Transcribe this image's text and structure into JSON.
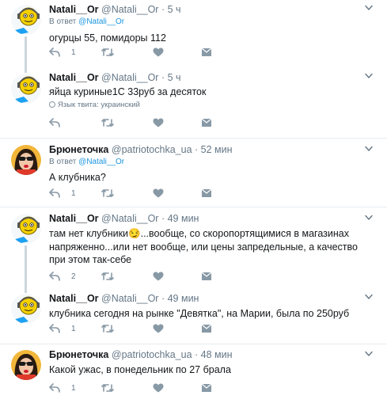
{
  "tweets": [
    {
      "name": "Natali__Or",
      "handle": "@Natali__Or",
      "dot": "·",
      "time": "5 ч",
      "reply_prefix": "В ответ",
      "reply_to": "@Natali__Or",
      "text": "огурцы 55, помидоры 112",
      "reply_count": "1",
      "lang": ""
    },
    {
      "name": "Natali__Or",
      "handle": "@Natali__Or",
      "dot": "·",
      "time": "5 ч",
      "reply_prefix": "",
      "reply_to": "",
      "text": "яйца куриные1С 33руб за десяток",
      "reply_count": "",
      "lang": "Язык твита: украинский"
    },
    {
      "name": "Брюнеточка",
      "handle": "@patriotochka_ua",
      "dot": "·",
      "time": "52 мин",
      "reply_prefix": "В ответ",
      "reply_to": "@Natali__Or",
      "text": "А клубника?",
      "reply_count": "1",
      "lang": ""
    },
    {
      "name": "Natali__Or",
      "handle": "@Natali__Or",
      "dot": "·",
      "time": "49 мин",
      "reply_prefix": "",
      "reply_to": "",
      "text": "там нет клубники😏...вообще, со скоропортящимися в магазинах напряженно...или нет вообще, или цены запредельные, а качество при этом так-себе",
      "reply_count": "2",
      "lang": ""
    },
    {
      "name": "Natali__Or",
      "handle": "@Natali__Or",
      "dot": "·",
      "time": "49 мин",
      "reply_prefix": "",
      "reply_to": "",
      "text": "клубника сегодня на рынке \"Девятка\", на Марии, была по  250руб",
      "reply_count": "1",
      "lang": ""
    },
    {
      "name": "Брюнеточка",
      "handle": "@patriotochka_ua",
      "dot": "·",
      "time": "48 мин",
      "reply_prefix": "",
      "reply_to": "",
      "text": "Какой ужас, в понедельник по 27 брала",
      "reply_count": "1",
      "lang": ""
    }
  ],
  "icons": {
    "reply": "reply-icon",
    "retweet": "retweet-icon",
    "like": "heart-icon",
    "dm": "envelope-icon",
    "menu": "chevron-down-icon"
  },
  "colors": {
    "link": "#1b95e0",
    "muted": "#657786",
    "thread": "#ccd6dd"
  }
}
